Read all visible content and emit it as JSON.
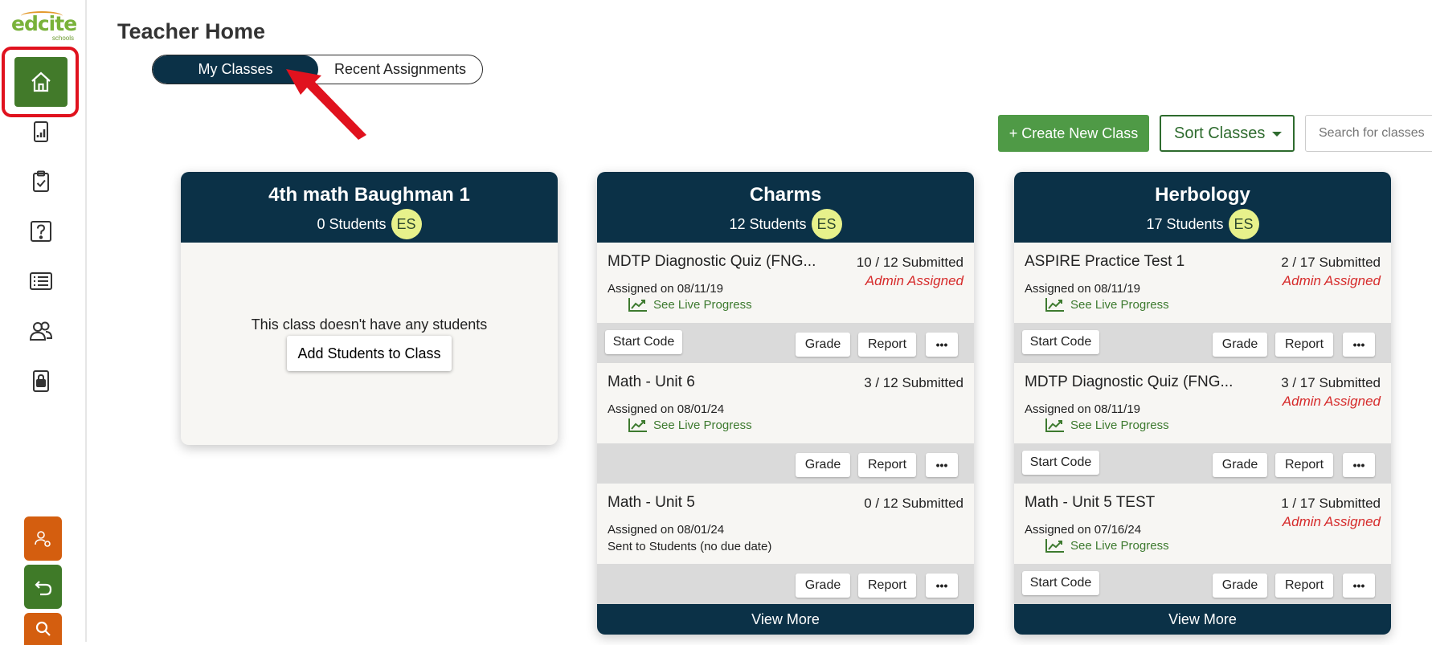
{
  "app": {
    "logo_text": "edcite",
    "logo_sub": "schools",
    "page_title": "Teacher Home"
  },
  "tabs": [
    {
      "label": "My Classes",
      "active": true
    },
    {
      "label": "Recent Assignments",
      "active": false
    }
  ],
  "sidebar": {
    "nav": [
      {
        "icon": "home-icon",
        "active": true
      },
      {
        "icon": "bar-chart-icon"
      },
      {
        "icon": "clipboard-check-icon"
      },
      {
        "icon": "question-icon"
      },
      {
        "icon": "list-icon"
      },
      {
        "icon": "users-icon"
      },
      {
        "icon": "lock-icon"
      }
    ],
    "tools": [
      {
        "icon": "user-settings-icon",
        "color": "#d45e0f"
      },
      {
        "icon": "undo-icon",
        "color": "#3f7a28"
      },
      {
        "icon": "search-icon",
        "color": "#d45e0f"
      }
    ]
  },
  "toolbar": {
    "create_label": "+ Create New Class",
    "sort_label": "Sort Classes",
    "search_placeholder": "Search for classes"
  },
  "colors": {
    "navy": "#0b3147",
    "green": "#4f9a46",
    "admin_red": "#d62b2b",
    "badge": "#e7f18b",
    "highlight": "#e0121e"
  },
  "classes": [
    {
      "name": "4th math Baughman 1",
      "students": "0 Students",
      "badge": "ES",
      "empty_text": "This class doesn't have any students",
      "add_students_label": "Add Students to Class"
    },
    {
      "name": "Charms",
      "students": "12 Students",
      "badge": "ES",
      "assignments": [
        {
          "title": "MDTP Diagnostic Quiz (FNG...",
          "submitted": "10 / 12 Submitted",
          "admin": "Admin Assigned",
          "date": "Assigned on 08/11/19",
          "live": "See Live Progress",
          "start_code": "Start Code"
        },
        {
          "title": "Math - Unit 6",
          "submitted": "3 / 12 Submitted",
          "date": "Assigned on 08/01/24",
          "live": "See Live Progress"
        },
        {
          "title": "Math - Unit 5",
          "submitted": "0 / 12 Submitted",
          "date": "Assigned on 08/01/24",
          "sent": "Sent to Students (no due date)"
        }
      ],
      "view_more": "View More"
    },
    {
      "name": "Herbology",
      "students": "17 Students",
      "badge": "ES",
      "assignments": [
        {
          "title": "ASPIRE Practice Test 1",
          "submitted": "2 / 17 Submitted",
          "admin": "Admin Assigned",
          "date": "Assigned on 08/11/19",
          "live": "See Live Progress",
          "start_code": "Start Code"
        },
        {
          "title": "MDTP Diagnostic Quiz (FNG...",
          "submitted": "3 / 17 Submitted",
          "admin": "Admin Assigned",
          "date": "Assigned on 08/11/19",
          "live": "See Live Progress",
          "start_code": "Start Code"
        },
        {
          "title": "Math - Unit 5 TEST",
          "submitted": "1 / 17 Submitted",
          "admin": "Admin Assigned",
          "date": "Assigned on 07/16/24",
          "live": "See Live Progress",
          "start_code": "Start Code"
        }
      ],
      "view_more": "View More"
    }
  ],
  "actions": {
    "grade": "Grade",
    "report": "Report",
    "more": "•••"
  }
}
